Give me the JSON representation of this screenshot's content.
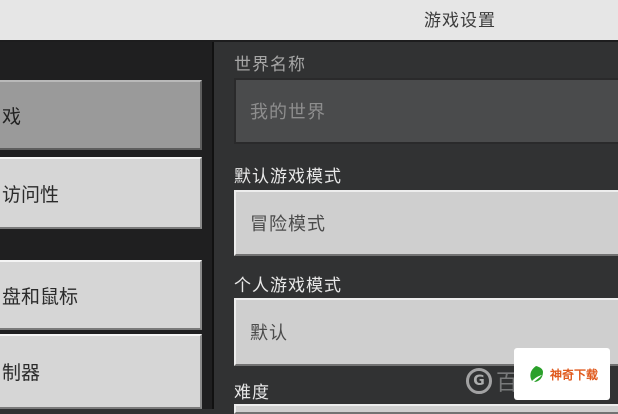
{
  "header": {
    "title": "游戏设置"
  },
  "sidebar": {
    "items": [
      {
        "label": "戏",
        "active": true
      },
      {
        "label": "访问性",
        "active": false
      },
      {
        "label": "盘和鼠标",
        "active": false
      },
      {
        "label": "制器",
        "active": false
      }
    ]
  },
  "settings": {
    "world_name": {
      "label": "世界名称",
      "value": "我的世界"
    },
    "default_game_mode": {
      "label": "默认游戏模式",
      "value": "冒险模式"
    },
    "personal_game_mode": {
      "label": "个人游戏模式",
      "value": "默认"
    },
    "difficulty": {
      "label": "难度"
    }
  },
  "watermark": {
    "text": "百",
    "brand": "神奇下载"
  }
}
